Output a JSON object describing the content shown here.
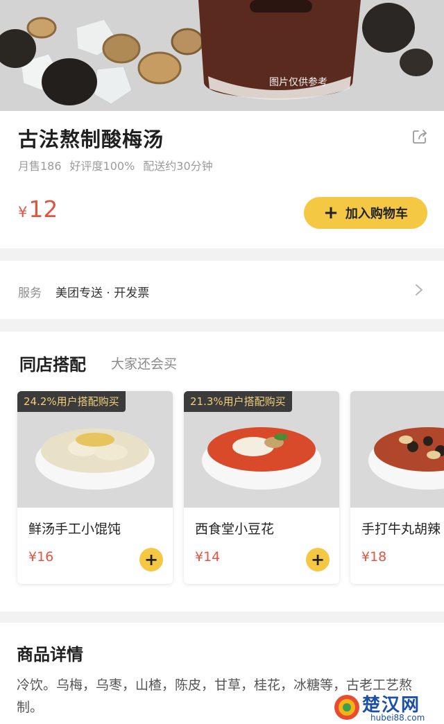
{
  "hero": {
    "watermark": "图片仅供参考"
  },
  "product": {
    "title": "古法熬制酸梅汤",
    "stats": {
      "monthly_sales": "月售186",
      "rating": "好评度100%",
      "delivery": "配送约30分钟"
    },
    "price_currency": "¥",
    "price_amount": "12",
    "add_to_cart_label": "加入购物车",
    "add_to_cart_icon": "plus-icon",
    "share_icon": "share-icon"
  },
  "service": {
    "label": "服务",
    "value": "美团专送 · 开发票",
    "chevron_icon": "chevron-right-icon"
  },
  "combo": {
    "title": "同店搭配",
    "subtitle": "大家还会买",
    "items": [
      {
        "badge": "24.2%用户搭配购买",
        "name": "鲜汤手工小馄饨",
        "price": "¥16"
      },
      {
        "badge": "21.3%用户搭配购买",
        "name": "西食堂小豆花",
        "price": "¥14"
      },
      {
        "badge": "",
        "name": "手打牛丸胡辣",
        "price": "¥18"
      }
    ]
  },
  "detail": {
    "title": "商品详情",
    "text": "冷饮。乌梅，乌枣，山楂，陈皮，甘草，桂花，冰糖等，古老工艺熬制。"
  },
  "site_logo": {
    "name": "楚汉网",
    "url": "hubei88.com"
  },
  "colors": {
    "accent_yellow": "#f5c844",
    "price_red": "#e05540",
    "badge_bg": "#3b3b3b",
    "badge_text": "#f1cf7b"
  }
}
